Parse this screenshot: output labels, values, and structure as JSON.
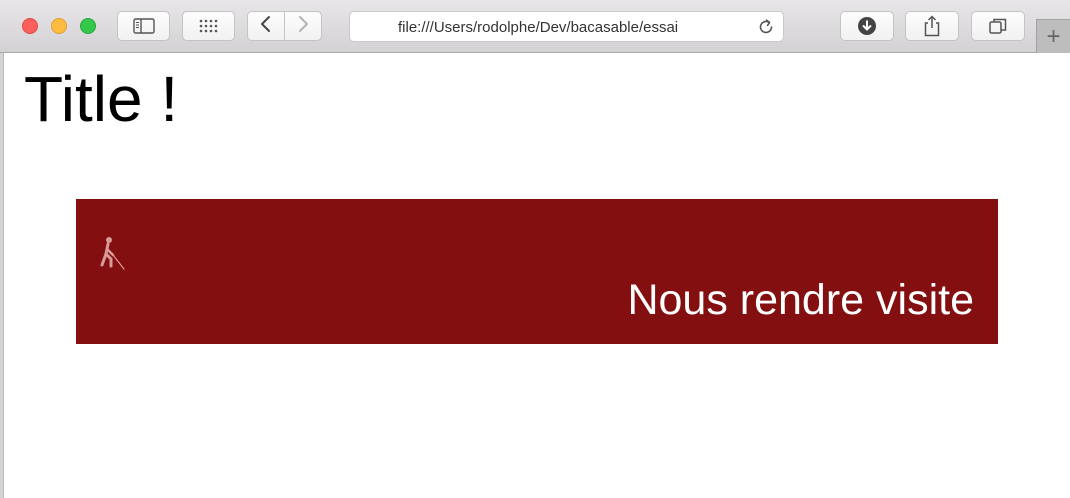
{
  "browser": {
    "address_bar": {
      "url": "file:///Users/rodolphe/Dev/bacasable/essai"
    },
    "new_tab_label": "+"
  },
  "page": {
    "title": "Title !",
    "banner": {
      "label": "Nous rendre visite",
      "icon": "blind-walker-icon",
      "background_color": "#840f10",
      "text_color": "#ffffff"
    }
  }
}
